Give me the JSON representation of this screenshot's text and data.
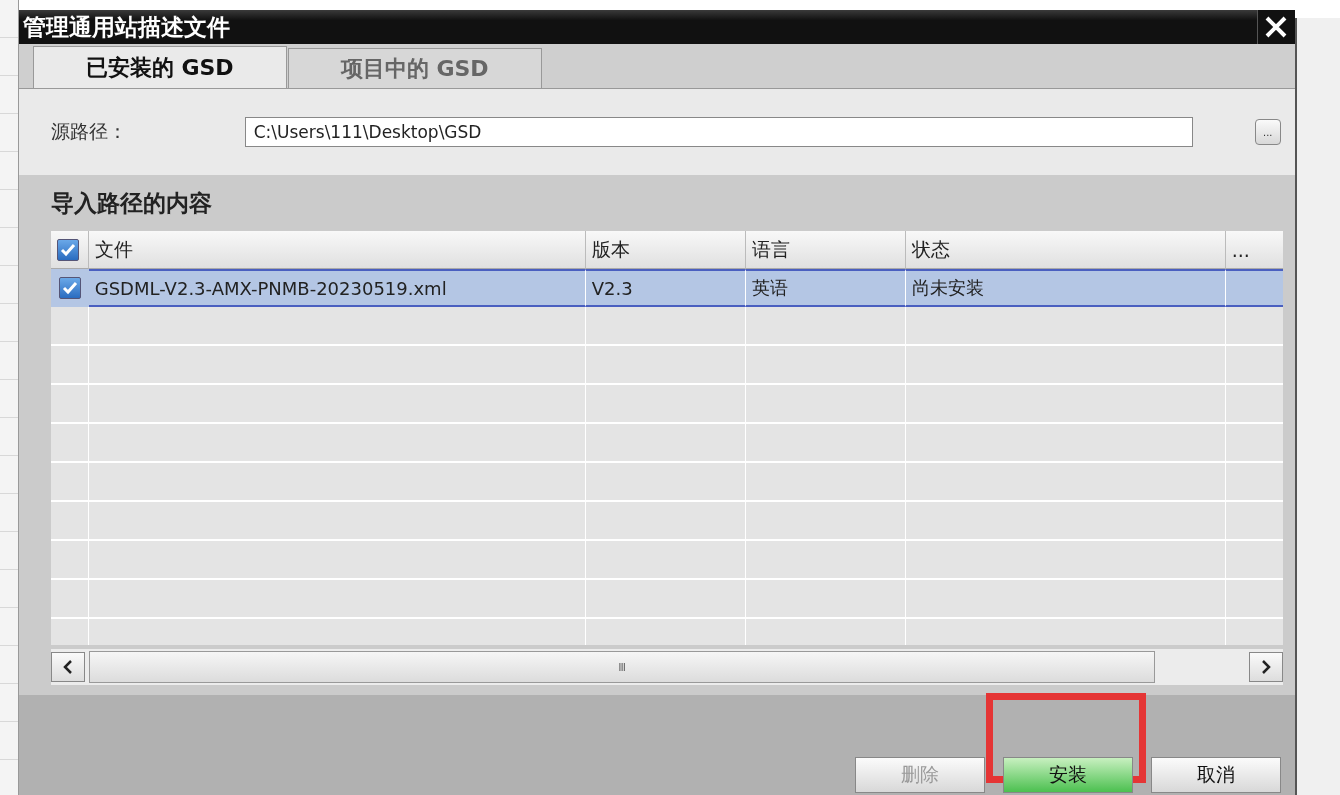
{
  "window": {
    "title": "管理通用站描述文件"
  },
  "tabs": [
    {
      "label": "已安装的 GSD",
      "selected": true
    },
    {
      "label": "项目中的 GSD",
      "selected": false
    }
  ],
  "source": {
    "label": "源路径：",
    "value": "C:\\Users\\111\\Desktop\\GSD",
    "browse": "..."
  },
  "section": {
    "title": "导入路径的内容"
  },
  "table": {
    "all_checked": true,
    "columns": [
      "文件",
      "版本",
      "语言",
      "状态",
      "..."
    ],
    "rows": [
      {
        "checked": true,
        "selected": true,
        "cells": [
          "GSDML-V2.3-AMX-PNMB-20230519.xml",
          "V2.3",
          "英语",
          "尚未安装",
          ""
        ]
      }
    ]
  },
  "scrollbar": {
    "thumb_grip": "III"
  },
  "buttons": [
    {
      "label": "删除",
      "disabled": true,
      "highlighted": false
    },
    {
      "label": "安装",
      "disabled": false,
      "highlighted": true
    },
    {
      "label": "取消",
      "disabled": false,
      "highlighted": false
    }
  ]
}
